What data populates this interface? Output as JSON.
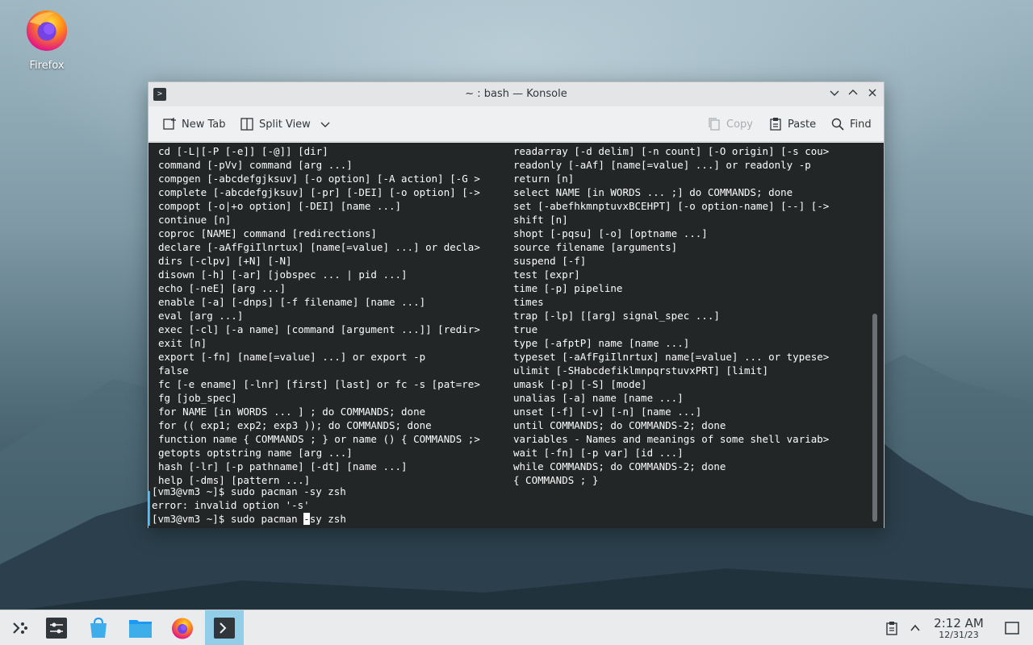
{
  "desktop": {
    "icons": [
      {
        "label": "Firefox"
      }
    ]
  },
  "window": {
    "title": "~ : bash — Konsole",
    "toolbar": {
      "new_tab": "New Tab",
      "split_view": "Split View",
      "copy": "Copy",
      "paste": "Paste",
      "find": "Find"
    }
  },
  "terminal": {
    "left_column": [
      "cd [-L|[-P [-e]] [-@]] [dir]",
      "command [-pVv] command [arg ...]",
      "compgen [-abcdefgjksuv] [-o option] [-A action] [-G >",
      "complete [-abcdefgjksuv] [-pr] [-DEI] [-o option] [->",
      "compopt [-o|+o option] [-DEI] [name ...]",
      "continue [n]",
      "coproc [NAME] command [redirections]",
      "declare [-aAfFgiIlnrtux] [name[=value] ...] or decla>",
      "dirs [-clpv] [+N] [-N]",
      "disown [-h] [-ar] [jobspec ... | pid ...]",
      "echo [-neE] [arg ...]",
      "enable [-a] [-dnps] [-f filename] [name ...]",
      "eval [arg ...]",
      "exec [-cl] [-a name] [command [argument ...]] [redir>",
      "exit [n]",
      "export [-fn] [name[=value] ...] or export -p",
      "false",
      "fc [-e ename] [-lnr] [first] [last] or fc -s [pat=re>",
      "fg [job_spec]",
      "for NAME [in WORDS ... ] ; do COMMANDS; done",
      "for (( exp1; exp2; exp3 )); do COMMANDS; done",
      "function name { COMMANDS ; } or name () { COMMANDS ;>",
      "getopts optstring name [arg ...]",
      "hash [-lr] [-p pathname] [-dt] [name ...]",
      "help [-dms] [pattern ...]"
    ],
    "right_column": [
      "readarray [-d delim] [-n count] [-O origin] [-s cou>",
      "readonly [-aAf] [name[=value] ...] or readonly -p",
      "return [n]",
      "select NAME [in WORDS ... ;] do COMMANDS; done",
      "set [-abefhkmnptuvxBCEHPT] [-o option-name] [--] [->",
      "shift [n]",
      "shopt [-pqsu] [-o] [optname ...]",
      "source filename [arguments]",
      "suspend [-f]",
      "test [expr]",
      "time [-p] pipeline",
      "times",
      "trap [-lp] [[arg] signal_spec ...]",
      "true",
      "type [-afptP] name [name ...]",
      "typeset [-aAfFgiIlnrtux] name[=value] ... or typese>",
      "ulimit [-SHabcdefiklmnpqrstuvxPRT] [limit]",
      "umask [-p] [-S] [mode]",
      "unalias [-a] name [name ...]",
      "unset [-f] [-v] [-n] [name ...]",
      "until COMMANDS; do COMMANDS-2; done",
      "variables - Names and meanings of some shell variab>",
      "wait [-fn] [-p var] [id ...]",
      "while COMMANDS; do COMMANDS-2; done",
      "{ COMMANDS ; }"
    ],
    "prompt_1": "[vm3@vm3 ~]$ sudo pacman -sy zsh",
    "error": "error: invalid option '-s'",
    "prompt_2_before": "[vm3@vm3 ~]$ sudo pacman ",
    "prompt_2_cursor": "-",
    "prompt_2_after": "sy zsh"
  },
  "taskbar": {
    "tasks": [
      "application-launcher-icon",
      "system-settings-icon",
      "discover-icon",
      "dolphin-icon",
      "firefox-icon",
      "konsole-icon"
    ],
    "clock": {
      "time": "2:12 AM",
      "date": "12/31/23"
    }
  },
  "colors": {
    "terminal_bg": "#232627",
    "terminal_fg": "#fcfcfc",
    "accent": "#3daee9",
    "active_task": "#93cee9"
  }
}
